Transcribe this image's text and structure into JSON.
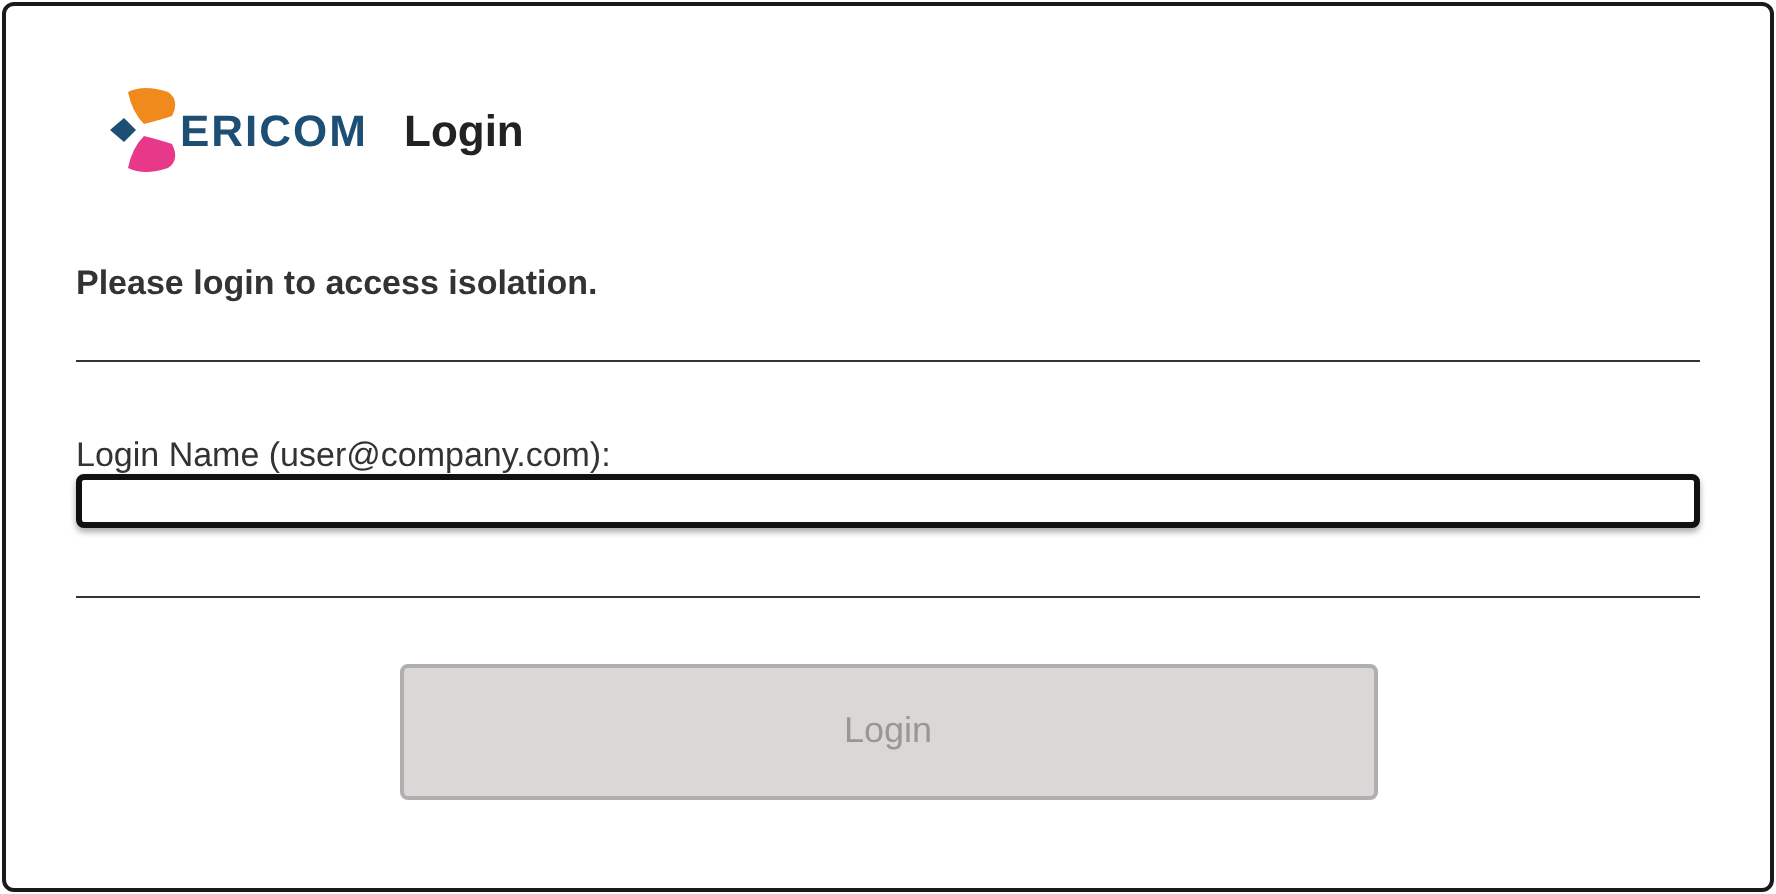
{
  "header": {
    "logo_text": "ERICOM",
    "title": "Login"
  },
  "message": "Please login to access isolation.",
  "login_name": {
    "label": "Login Name (user@company.com):",
    "focused": true
  },
  "login_button": {
    "label": "Login",
    "disabled": true
  }
}
